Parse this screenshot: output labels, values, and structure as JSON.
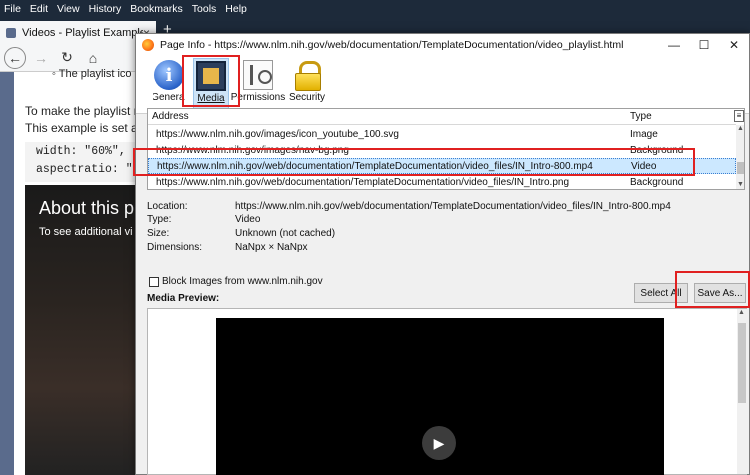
{
  "browser": {
    "menu": [
      "File",
      "Edit",
      "View",
      "History",
      "Bookmarks",
      "Tools",
      "Help"
    ],
    "tab_title": "Videos - Playlist Example",
    "tab_close": "×",
    "new_tab": "+",
    "page": {
      "bullet": "◦  The playlist ico",
      "line1": "To make the playlist re",
      "line2": "This example is set at (",
      "code1": "width: \"60%\",",
      "code2": "aspectratio: \"1",
      "video_title": "About this p",
      "video_sub": "To see additional vi"
    }
  },
  "dialog": {
    "title": "Page Info - https://www.nlm.nih.gov/web/documentation/TemplateDocumentation/video_playlist.html",
    "controls": {
      "minimize": "—",
      "maximize": "☐",
      "close": "✕"
    },
    "toolbar": [
      {
        "label": "General",
        "icon": "info-icon"
      },
      {
        "label": "Media",
        "icon": "media-icon"
      },
      {
        "label": "Permissions",
        "icon": "permissions-icon"
      },
      {
        "label": "Security",
        "icon": "lock-icon"
      }
    ],
    "table": {
      "col_address": "Address",
      "col_type": "Type",
      "rows": [
        {
          "address": "https://www.nlm.nih.gov/images/icon_youtube_100.svg",
          "type": "Image"
        },
        {
          "address": "https://www.nlm.nih.gov/images/nav-bg.png",
          "type": "Background"
        },
        {
          "address": "https://www.nlm.nih.gov/web/documentation/TemplateDocumentation/video_files/IN_Intro-800.mp4",
          "type": "Video"
        },
        {
          "address": "https://www.nlm.nih.gov/web/documentation/TemplateDocumentation/video_files/IN_Intro.png",
          "type": "Background"
        }
      ],
      "selected_index": 2
    },
    "details": {
      "location_label": "Location:",
      "location_value": "https://www.nlm.nih.gov/web/documentation/TemplateDocumentation/video_files/IN_Intro-800.mp4",
      "type_label": "Type:",
      "type_value": "Video",
      "size_label": "Size:",
      "size_value": "Unknown (not cached)",
      "dimensions_label": "Dimensions:",
      "dimensions_value": "NaNpx × NaNpx"
    },
    "block_images": "Block Images from www.nlm.nih.gov",
    "block_checked": false,
    "preview_label": "Media Preview:",
    "select_all": "Select All",
    "save_as": "Save As..."
  }
}
